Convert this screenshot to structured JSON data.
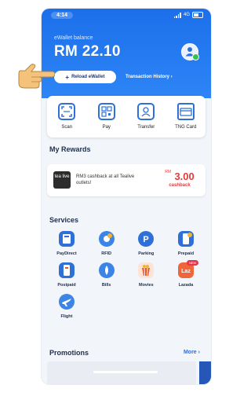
{
  "status_bar": {
    "time": "4:14",
    "network": "4G"
  },
  "wallet": {
    "balance_label": "eWallet balance",
    "balance": "RM 22.10"
  },
  "actions": {
    "reload": "Reload eWallet",
    "history": "Transaction History"
  },
  "quick_actions": [
    {
      "label": "Scan",
      "icon": "scan-icon"
    },
    {
      "label": "Pay",
      "icon": "qr-pay-icon"
    },
    {
      "label": "Transfer",
      "icon": "transfer-icon"
    },
    {
      "label": "TNG Card",
      "icon": "card-icon"
    }
  ],
  "rewards": {
    "title": "My Rewards",
    "item": {
      "logo_text": "tea live",
      "description": "RM3 cashback at all Tealive outlets!",
      "currency": "RM",
      "amount": "3.00",
      "tag": "cashback"
    }
  },
  "services": {
    "title": "Services",
    "items": [
      {
        "label": "PayDirect",
        "icon": "paydirect-icon",
        "color": "#2f70d8"
      },
      {
        "label": "RFID",
        "icon": "rfid-icon",
        "color": "#3c84e6"
      },
      {
        "label": "Parking",
        "icon": "parking-icon",
        "color": "#2f70d8"
      },
      {
        "label": "Prepaid",
        "icon": "prepaid-icon",
        "color": "#2f70d8"
      },
      {
        "label": "Postpaid",
        "icon": "postpaid-icon",
        "color": "#2f70d8"
      },
      {
        "label": "Bills",
        "icon": "bills-icon",
        "color": "#3c84e6"
      },
      {
        "label": "Movies",
        "icon": "movies-icon",
        "color": "#e9562b"
      },
      {
        "label": "Lazada",
        "icon": "lazada-icon",
        "color": "#f0663c",
        "badge": "NEW"
      },
      {
        "label": "Flight",
        "icon": "flight-icon",
        "color": "#3c84e6"
      }
    ]
  },
  "promotions": {
    "title": "Promotions",
    "more": "More"
  },
  "colors": {
    "brand_blue": "#1c6fea",
    "accent_red": "#e23b3b"
  }
}
